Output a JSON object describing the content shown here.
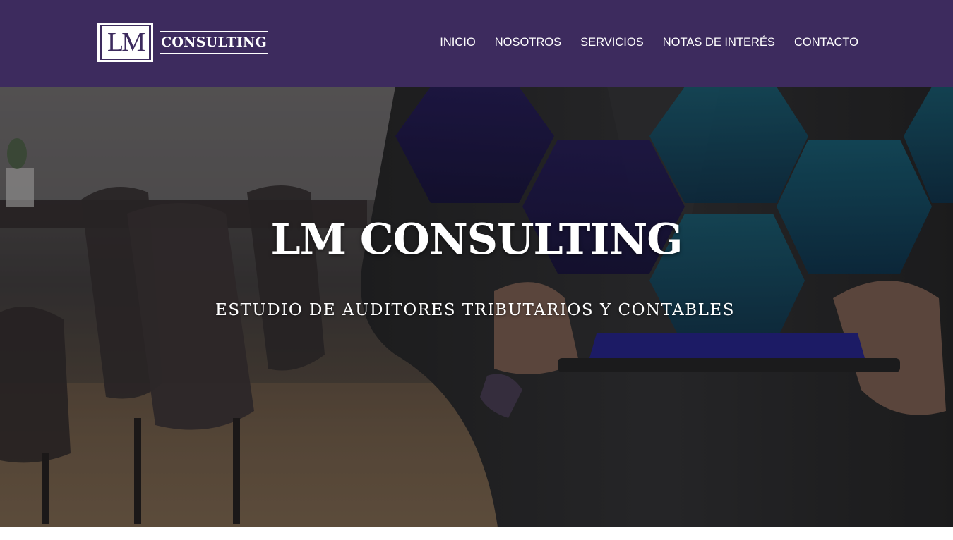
{
  "colors": {
    "header_bg": "#3d2b5e",
    "text": "#ffffff",
    "hex_accent": "#1a8fa8"
  },
  "logo": {
    "monogram": "LM",
    "word": "CONSULTING"
  },
  "nav": {
    "items": [
      {
        "label": "INICIO"
      },
      {
        "label": "NOSOTROS"
      },
      {
        "label": "SERVICIOS"
      },
      {
        "label": "NOTAS DE INTERÉS"
      },
      {
        "label": "CONTACTO"
      }
    ]
  },
  "hero": {
    "title": "LM CONSULTING",
    "subtitle": "ESTUDIO DE AUDITORES TRIBUTARIOS Y CONTABLES"
  }
}
